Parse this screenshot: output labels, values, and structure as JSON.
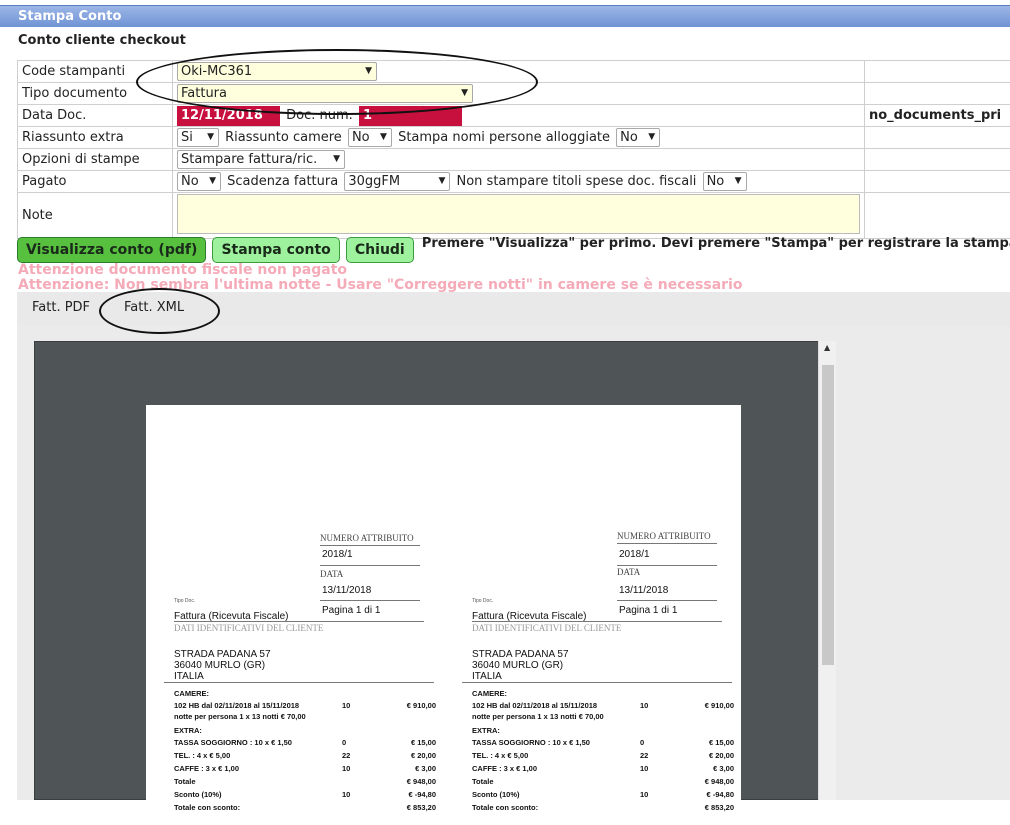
{
  "window": {
    "title": "Stampa Conto"
  },
  "header": {
    "subtitle": "Conto cliente checkout"
  },
  "form": {
    "printers_label": "Code stampanti",
    "printer_value": "Oki-MC361",
    "doctype_label": "Tipo documento",
    "doctype_value": "Fattura",
    "date_label": "Data Doc.",
    "date_value": "12/11/2018",
    "docnum_label": "Doc. num.",
    "docnum_value": "1",
    "right_notice": "no_documents_pri",
    "extra_label": "Riassunto extra",
    "extra_value": "Si",
    "rooms_label": "Riassunto camere",
    "rooms_value": "No",
    "names_label": "Stampa nomi persone alloggiate",
    "names_value": "No",
    "printopt_label": "Opzioni di stampe",
    "printopt_value": "Stampare fattura/ric.",
    "paid_label": "Pagato",
    "paid_value": "No",
    "due_label": "Scadenza fattura",
    "due_value": "30ggFM",
    "nofiscal_label": "Non stampare titoli spese doc. fiscali",
    "nofiscal_value": "No",
    "note_label": "Note",
    "note_value": ""
  },
  "buttons": {
    "view": "Visualizza conto (pdf)",
    "print": "Stampa conto",
    "close": "Chiudi",
    "hint": "Premere \"Visualizza\" per primo. Devi premere \"Stampa\" per registrare la stampa"
  },
  "warnings": [
    "Attenzione documento fiscale non pagato",
    "Attenzione: Non sembra l'ultima notte - Usare \"Correggere notti\" in camere se è necessario"
  ],
  "tabs": [
    "Fatt. PDF",
    "Fatt. XML"
  ],
  "invoice": {
    "num_attr_label": "NUMERO ATTRIBUITO",
    "num_attr_value": "2018/1",
    "date_label": "DATA",
    "date_value": "13/11/2018",
    "page_value": "Pagina 1 di 1",
    "tipo_doc_label": "Tipo Doc.",
    "tipo_doc_value": "Fattura (Ricevuta Fiscale)",
    "client_label": "DATI IDENTIFICATIVI DEL CLIENTE",
    "address": [
      "STRADA PADANA 57",
      "36040 MURLO (GR)",
      "ITALIA"
    ],
    "rows": [
      {
        "desc": "CAMERE:",
        "qty": "",
        "amount": ""
      },
      {
        "desc": "102 HB dal 02/11/2018 al 15/11/2018",
        "qty": "10",
        "amount": "€ 910,00"
      },
      {
        "desc": "notte per persona 1 x 13 notti € 70,00",
        "qty": "",
        "amount": ""
      },
      {
        "desc": "EXTRA:",
        "qty": "",
        "amount": ""
      },
      {
        "desc": "TASSA SOGGIORNO : 10 x € 1,50",
        "qty": "0",
        "amount": "€ 15,00"
      },
      {
        "desc": "TEL. : 4 x € 5,00",
        "qty": "22",
        "amount": "€ 20,00"
      },
      {
        "desc": "CAFFE : 3 x € 1,00",
        "qty": "10",
        "amount": "€ 3,00"
      },
      {
        "desc": "Totale",
        "qty": "",
        "amount": "€ 948,00"
      },
      {
        "desc": "Sconto  (10%)",
        "qty": "10",
        "amount": "€ -94,80"
      },
      {
        "desc": "Totale con sconto:",
        "qty": "",
        "amount": "€ 853,20"
      }
    ]
  },
  "colors": {
    "accent_red": "#c8103f",
    "button_green": "#9ef29e",
    "warning_pink": "#f5aab8",
    "title_blue": "#7b9ad8"
  }
}
